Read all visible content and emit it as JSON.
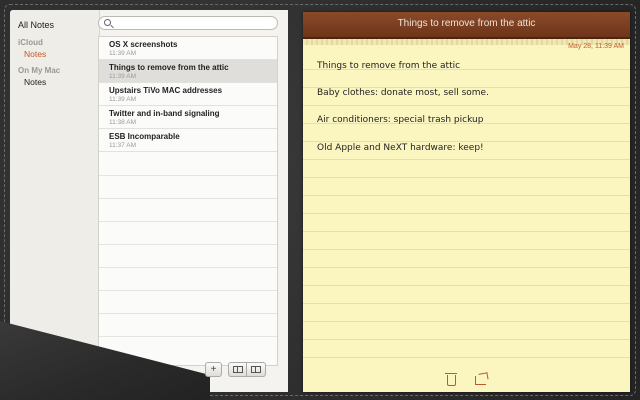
{
  "sidebar": {
    "all_notes": "All Notes",
    "groups": [
      {
        "heading": "iCloud",
        "items": [
          {
            "label": "Notes",
            "active": true
          }
        ]
      },
      {
        "heading": "On My Mac",
        "items": [
          {
            "label": "Notes",
            "active": false
          }
        ]
      }
    ]
  },
  "search": {
    "placeholder": ""
  },
  "notes": [
    {
      "title": "OS X screenshots",
      "time": "11:39 AM"
    },
    {
      "title": "Things to remove from the attic",
      "time": "11:39 AM"
    },
    {
      "title": "Upstairs TiVo MAC addresses",
      "time": "11:39 AM"
    },
    {
      "title": "Twitter and in-band signaling",
      "time": "11:38 AM"
    },
    {
      "title": "ESB Incomparable",
      "time": "11:37 AM"
    }
  ],
  "selected_index": 1,
  "footer": {
    "add_label": "+"
  },
  "editor": {
    "title": "Things to remove from the attic",
    "timestamp": "May 28, 11:39 AM",
    "lines": [
      "Things to remove from the attic",
      "Baby clothes: donate most, sell some.",
      "Air conditioners: special trash pickup",
      "Old Apple and NeXT hardware: keep!"
    ]
  },
  "colors": {
    "accent": "#c2572e",
    "header": "#6e3519",
    "pad": "#fbf6c0"
  }
}
